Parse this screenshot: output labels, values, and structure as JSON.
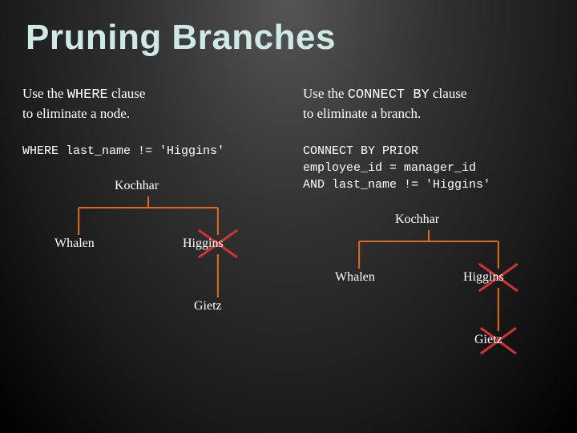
{
  "title": "Pruning Branches",
  "left": {
    "desc_pre": "Use the ",
    "desc_code": "WHERE",
    "desc_post": " clause\nto eliminate a node.",
    "sql": "WHERE last_name != 'Higgins'",
    "nodes": {
      "root": "Kochhar",
      "l": "Whalen",
      "r": "Higgins",
      "leaf": "Gietz"
    }
  },
  "right": {
    "desc_pre": "Use the ",
    "desc_code": "CONNECT BY",
    "desc_post": " clause\nto eliminate a branch.",
    "sql": "CONNECT BY PRIOR\nemployee_id = manager_id\nAND last_name != 'Higgins'",
    "nodes": {
      "root": "Kochhar",
      "l": "Whalen",
      "r": "Higgins",
      "leaf": "Gietz"
    }
  }
}
